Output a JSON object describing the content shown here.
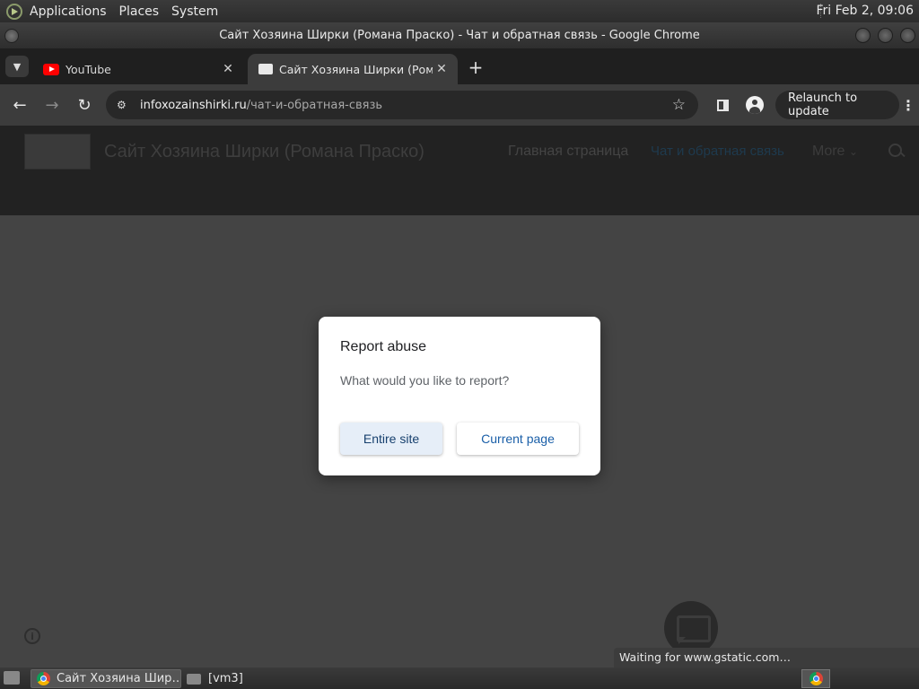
{
  "top_panel": {
    "menus": [
      "Applications",
      "Places",
      "System"
    ],
    "clock": "Fri Feb  2, 09:06"
  },
  "window": {
    "title": "Сайт Хозяина Ширки (Романа Праско) - Чат и обратная связь - Google Chrome"
  },
  "tabs": [
    {
      "label": "YouTube",
      "icon": "youtube-icon"
    },
    {
      "label": "Сайт Хозяина Ширки (Романа Праско)",
      "icon": "site-favicon",
      "active": true
    }
  ],
  "toolbar": {
    "url_host": "infoxozainshirki.ru",
    "url_path": "/чат-и-обратная-связь",
    "relaunch_label": "Relaunch to update"
  },
  "site": {
    "title": "Сайт Хозяина Ширки (Романа Праско)",
    "nav": {
      "home": "Главная страница",
      "chat": "Чат и обратная связь",
      "more": "More"
    }
  },
  "dialog": {
    "title": "Report abuse",
    "question": "What would you like to report?",
    "entire_site": "Entire site",
    "current_page": "Current page"
  },
  "status": "Waiting for www.gstatic.com…",
  "taskbar": {
    "items": [
      "Сайт Хозяина Шир…",
      "[vm3]"
    ]
  },
  "colors": {
    "dialog_button_text": "#1a5fa8",
    "dialog_primary_bg": "#e6eef8"
  }
}
